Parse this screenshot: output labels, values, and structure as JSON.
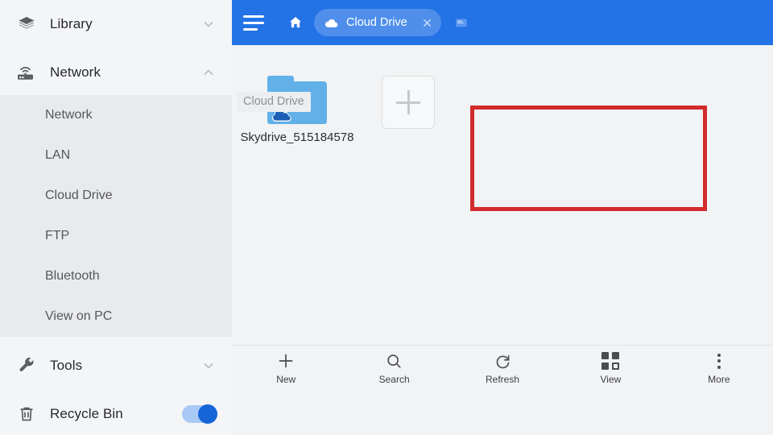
{
  "window": {
    "accent_blue": "#2373e6",
    "highlight_red": "#d22b2b",
    "sidebar_bg": "#f4f5f7",
    "submenu_bg": "#e9eaec",
    "folder_blue": "#62b0e8"
  },
  "sidebar": {
    "groups": [
      {
        "label": "Library",
        "icon": "layers-stack-icon",
        "chevron": "chevron-down-icon",
        "expanded": false
      },
      {
        "label": "Network",
        "icon": "router-wifi-icon",
        "chevron": "chevron-up-icon",
        "expanded": true
      }
    ],
    "sub_items": [
      {
        "label": "Network"
      },
      {
        "label": "LAN"
      },
      {
        "label": "Cloud Drive"
      },
      {
        "label": "FTP"
      },
      {
        "label": "Bluetooth"
      },
      {
        "label": "View on PC"
      }
    ],
    "tools": {
      "label": "Tools",
      "icon": "wrench-icon",
      "chevron": "chevron-down-icon"
    },
    "recycle": {
      "label": "Recycle Bin",
      "icon": "trash-icon",
      "toggle_state": "on"
    }
  },
  "header": {
    "menu_icon": "hamburger-menu-icon",
    "home_icon": "home-icon",
    "tab": {
      "icon": "cloud-icon",
      "title": "Cloud Drive",
      "close_icon": "close-x-icon"
    },
    "new_tab_icon": "new-tab-icon"
  },
  "breadcrumb": {
    "path": "Cloud Drive"
  },
  "content": {
    "items": [
      {
        "name": "Skydrive_515184578",
        "icon": "folder-onedrive-icon",
        "type": "folder"
      }
    ],
    "add_button": {
      "icon": "plus-icon",
      "label": ""
    }
  },
  "toolbar": {
    "buttons": [
      {
        "label": "New",
        "icon": "plus-icon"
      },
      {
        "label": "Search",
        "icon": "search-icon"
      },
      {
        "label": "Refresh",
        "icon": "refresh-icon"
      },
      {
        "label": "View",
        "icon": "grid-view-icon"
      },
      {
        "label": "More",
        "icon": "more-vertical-icon"
      }
    ]
  }
}
